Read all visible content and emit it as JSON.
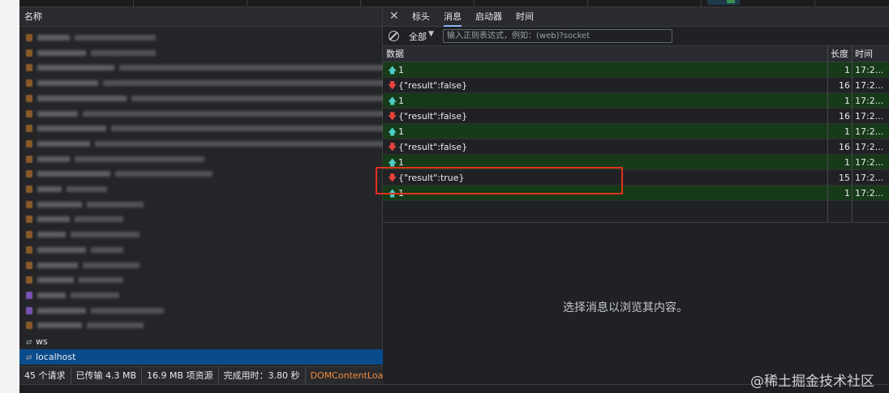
{
  "left_panel": {
    "header": "名称",
    "requests": [
      {
        "name": "ws",
        "selected": false
      },
      {
        "name": "localhost",
        "selected": true
      }
    ]
  },
  "status_bar": {
    "requests": "45 个请求",
    "transferred": "已传输 4.3 MB",
    "resources": "16.9 MB 项资源",
    "finish": "完成用时：3.80 秒",
    "dcl": "DOMContentLoad"
  },
  "right_panel": {
    "tabs": [
      {
        "label": "标头",
        "active": false
      },
      {
        "label": "消息",
        "active": true
      },
      {
        "label": "启动器",
        "active": false
      },
      {
        "label": "时间",
        "active": false
      }
    ],
    "filter": {
      "selected": "全部",
      "placeholder": "输入正则表达式，例如：(web)?socket"
    },
    "columns": {
      "data": "数据",
      "length": "长度",
      "time": "时间"
    },
    "messages": [
      {
        "dir": "up",
        "data": "1",
        "length": "1",
        "time": "17:2..."
      },
      {
        "dir": "down",
        "data": "{\"result\":false}",
        "length": "16",
        "time": "17:2..."
      },
      {
        "dir": "up",
        "data": "1",
        "length": "1",
        "time": "17:2..."
      },
      {
        "dir": "down",
        "data": "{\"result\":false}",
        "length": "16",
        "time": "17:2..."
      },
      {
        "dir": "up",
        "data": "1",
        "length": "1",
        "time": "17:2..."
      },
      {
        "dir": "down",
        "data": "{\"result\":false}",
        "length": "16",
        "time": "17:2..."
      },
      {
        "dir": "up",
        "data": "1",
        "length": "1",
        "time": "17:2..."
      },
      {
        "dir": "down",
        "data": "{\"result\":true}",
        "length": "15",
        "time": "17:2..."
      },
      {
        "dir": "up",
        "data": "1",
        "length": "1",
        "time": "17:2..."
      }
    ],
    "empty_message": "选择消息以浏览其内容。"
  },
  "watermark": "@稀土掘金技术社区",
  "colors": {
    "sent_row": "#173a18",
    "selected_request": "#0a4b8c",
    "highlight_box": "#e0321c",
    "active_tab_underline": "#8ab4f8",
    "arrow_up": "#4ecdc4",
    "arrow_down": "#e8423c"
  }
}
